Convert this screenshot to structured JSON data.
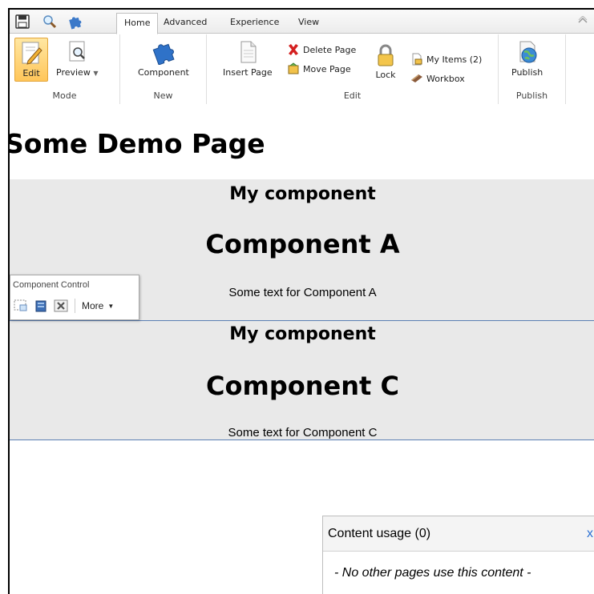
{
  "ribbon": {
    "tabs": [
      "Home",
      "Advanced",
      "Experience",
      "View"
    ],
    "active_tab": "Home",
    "groups": {
      "mode": {
        "label": "Mode",
        "edit": "Edit",
        "preview": "Preview"
      },
      "new": {
        "label": "New",
        "component": "Component"
      },
      "edit": {
        "label": "Edit",
        "insert_page": "Insert Page",
        "delete_page": "Delete Page",
        "move_page": "Move Page",
        "lock": "Lock",
        "my_items": "My Items (2)",
        "workbox": "Workbox"
      },
      "publish": {
        "label": "Publish",
        "publish": "Publish"
      }
    }
  },
  "page": {
    "title": "Some Demo Page",
    "components": [
      {
        "heading": "My component",
        "title": "Component A",
        "text": "Some text for Component A"
      },
      {
        "heading": "My component",
        "title": "Component C",
        "text": "Some text for Component C"
      }
    ]
  },
  "component_control": {
    "title": "Component Control",
    "more": "More"
  },
  "content_usage": {
    "title": "Content usage (0)",
    "close": "x",
    "message": "- No other pages use this content -"
  },
  "colors": {
    "component_bg": "#e9e9e9",
    "component_border": "#5b7fb4",
    "link_blue": "#2a6fd3",
    "edit_highlight": "#ffc65a"
  }
}
